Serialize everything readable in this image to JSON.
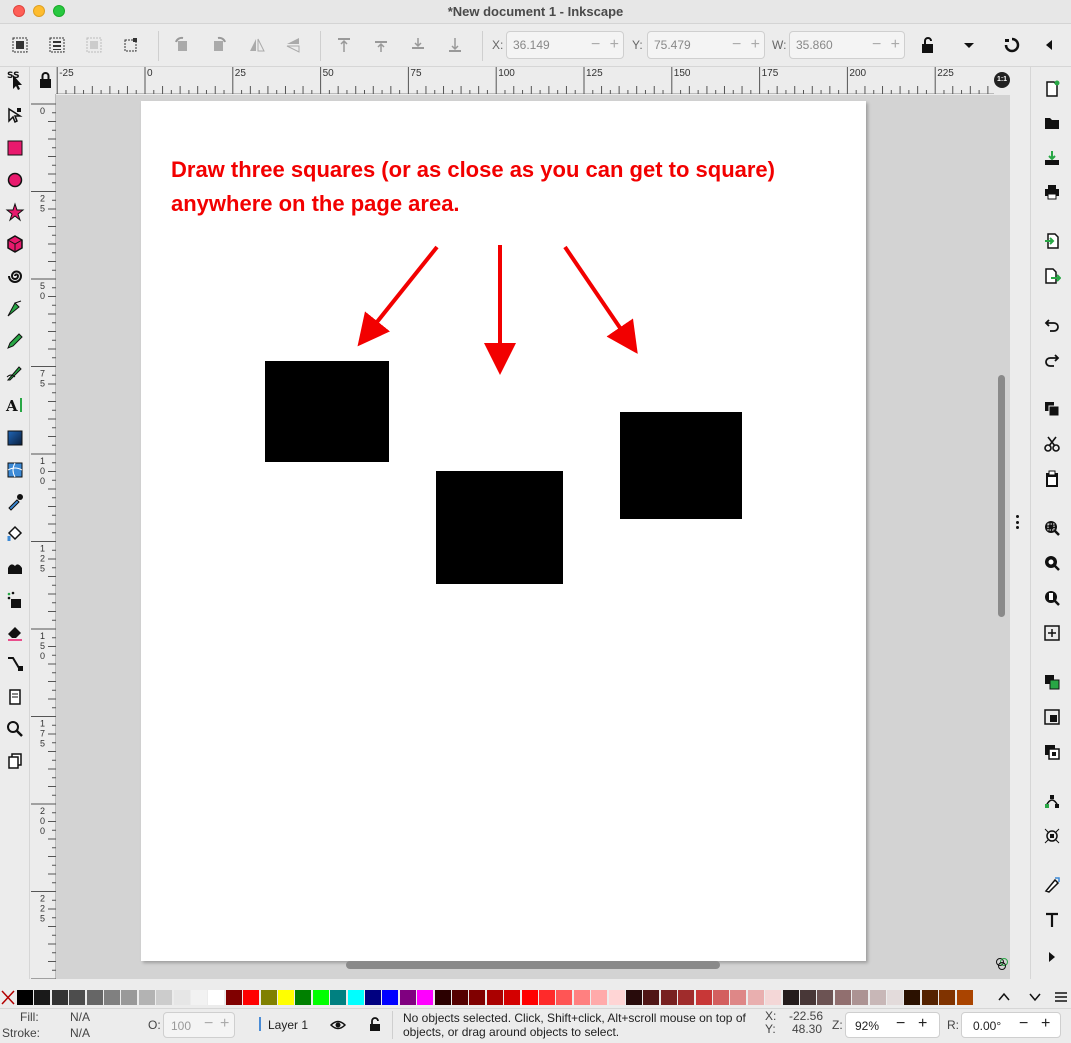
{
  "window": {
    "title": "*New document 1 - Inkscape"
  },
  "toolbar": {
    "x_label": "X:",
    "x_value": "36.149",
    "y_label": "Y:",
    "y_value": "75.479",
    "w_label": "W:",
    "w_value": "35.860"
  },
  "rulers": {
    "top_labels": [
      "-25",
      "0",
      "25",
      "50",
      "75",
      "100",
      "125",
      "150",
      "175",
      "200",
      "225"
    ],
    "left_labels": [
      "0",
      "25",
      "50",
      "75",
      "100",
      "125",
      "150",
      "175",
      "200",
      "225"
    ],
    "corner_label": "1:1"
  },
  "canvas": {
    "instruction_line1": "Draw three squares (or as close as you can get to square)",
    "instruction_line2": "anywhere on the page area.",
    "text_color": "#f20000"
  },
  "palette": {
    "colors": [
      "#000000",
      "#1a1a1a",
      "#333333",
      "#4d4d4d",
      "#666666",
      "#808080",
      "#999999",
      "#b3b3b3",
      "#cccccc",
      "#e6e6e6",
      "#f2f2f2",
      "#ffffff",
      "#800000",
      "#ff0000",
      "#808000",
      "#ffff00",
      "#008000",
      "#00ff00",
      "#008080",
      "#00ffff",
      "#000080",
      "#0000ff",
      "#800080",
      "#ff00ff",
      "#2b0000",
      "#550000",
      "#800000",
      "#aa0000",
      "#d40000",
      "#ff0000",
      "#ff2a2a",
      "#ff5555",
      "#ff8080",
      "#ffaaaa",
      "#ffd5d5",
      "#280b0b",
      "#501616",
      "#782121",
      "#a02c2c",
      "#c83737",
      "#d35f5f",
      "#de8787",
      "#e9afaf",
      "#f4d7d7",
      "#241c1c",
      "#483737",
      "#6c5353",
      "#916f6f",
      "#ac9393",
      "#c8b7b7",
      "#e3dbdb",
      "#2b1100",
      "#552200",
      "#803300",
      "#aa4400"
    ]
  },
  "status": {
    "fill_label": "Fill:",
    "fill_value": "N/A",
    "stroke_label": "Stroke:",
    "stroke_value": "N/A",
    "opacity_label": "O:",
    "opacity_value": "100",
    "layer_name": "Layer 1",
    "message_line1": "No objects selected. Click, Shift+click, Alt+scroll mouse on top of",
    "message_line2": "objects, or drag around objects to select.",
    "cursor_x_label": "X:",
    "cursor_x": "-22.56",
    "cursor_y_label": "Y:",
    "cursor_y": "48.30",
    "zoom_label": "Z:",
    "zoom_value": "92%",
    "rotation_label": "R:",
    "rotation_value": "0.00°"
  }
}
